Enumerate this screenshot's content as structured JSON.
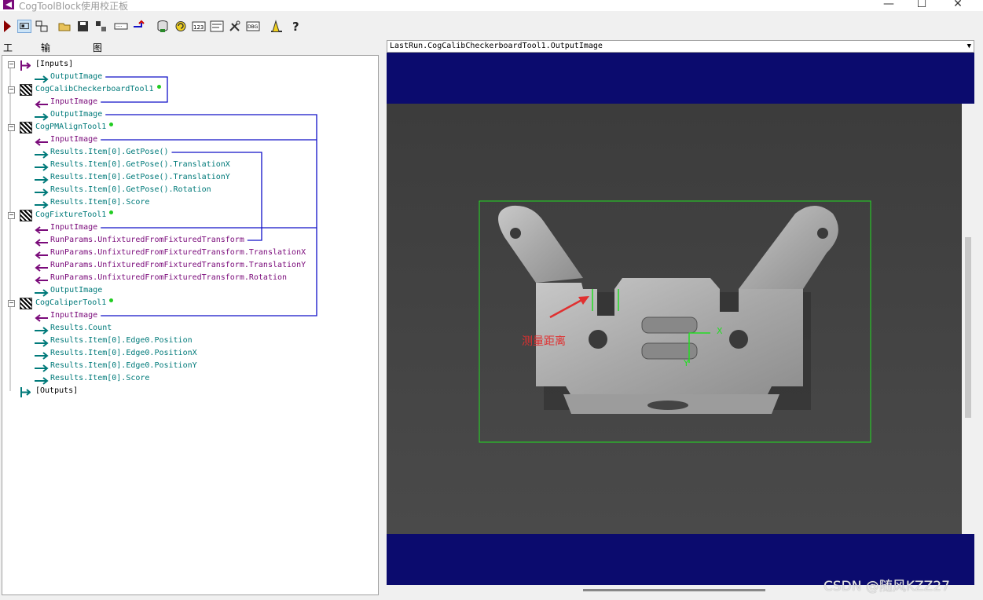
{
  "window": {
    "title": "CogToolBlock使用校正板"
  },
  "tabs": [
    "工具",
    "输入/输出",
    "图形"
  ],
  "tree": [
    {
      "text": "[Inputs]",
      "color": "black",
      "indent": 0,
      "node": true,
      "icon": "inputs-icon"
    },
    {
      "text": "OutputImage",
      "color": "teal",
      "indent": 2,
      "arrow": "out"
    },
    {
      "text": "CogCalibCheckerboardTool1",
      "color": "teal",
      "indent": 1,
      "node": true,
      "icon": "checkerboard-tool-icon",
      "status": true
    },
    {
      "text": "InputImage",
      "color": "purple",
      "indent": 2,
      "arrow": "in"
    },
    {
      "text": "OutputImage",
      "color": "teal",
      "indent": 2,
      "arrow": "out"
    },
    {
      "text": "CogPMAlignTool1",
      "color": "teal",
      "indent": 1,
      "node": true,
      "icon": "pmalign-tool-icon",
      "status": true
    },
    {
      "text": "InputImage",
      "color": "purple",
      "indent": 2,
      "arrow": "in"
    },
    {
      "text": "Results.Item[0].GetPose()",
      "color": "teal",
      "indent": 2,
      "arrow": "out"
    },
    {
      "text": "Results.Item[0].GetPose().TranslationX",
      "color": "teal",
      "indent": 2,
      "arrow": "out"
    },
    {
      "text": "Results.Item[0].GetPose().TranslationY",
      "color": "teal",
      "indent": 2,
      "arrow": "out"
    },
    {
      "text": "Results.Item[0].GetPose().Rotation",
      "color": "teal",
      "indent": 2,
      "arrow": "out"
    },
    {
      "text": "Results.Item[0].Score",
      "color": "teal",
      "indent": 2,
      "arrow": "out"
    },
    {
      "text": "CogFixtureTool1",
      "color": "teal",
      "indent": 1,
      "node": true,
      "icon": "fixture-tool-icon",
      "status": true
    },
    {
      "text": "InputImage",
      "color": "purple",
      "indent": 2,
      "arrow": "in"
    },
    {
      "text": "RunParams.UnfixturedFromFixturedTransform",
      "color": "purple",
      "indent": 2,
      "arrow": "in"
    },
    {
      "text": "RunParams.UnfixturedFromFixturedTransform.TranslationX",
      "color": "purple",
      "indent": 2,
      "arrow": "in"
    },
    {
      "text": "RunParams.UnfixturedFromFixturedTransform.TranslationY",
      "color": "purple",
      "indent": 2,
      "arrow": "in"
    },
    {
      "text": "RunParams.UnfixturedFromFixturedTransform.Rotation",
      "color": "purple",
      "indent": 2,
      "arrow": "in"
    },
    {
      "text": "OutputImage",
      "color": "teal",
      "indent": 2,
      "arrow": "out"
    },
    {
      "text": "CogCaliperTool1",
      "color": "teal",
      "indent": 1,
      "node": true,
      "icon": "caliper-tool-icon",
      "status": true
    },
    {
      "text": "InputImage",
      "color": "purple",
      "indent": 2,
      "arrow": "in"
    },
    {
      "text": "Results.Count",
      "color": "teal",
      "indent": 2,
      "arrow": "out"
    },
    {
      "text": "Results.Item[0].Edge0.Position",
      "color": "teal",
      "indent": 2,
      "arrow": "out"
    },
    {
      "text": "Results.Item[0].Edge0.PositionX",
      "color": "teal",
      "indent": 2,
      "arrow": "out"
    },
    {
      "text": "Results.Item[0].Edge0.PositionY",
      "color": "teal",
      "indent": 2,
      "arrow": "out"
    },
    {
      "text": "Results.Item[0].Score",
      "color": "teal",
      "indent": 2,
      "arrow": "out"
    },
    {
      "text": "[Outputs]",
      "color": "black",
      "indent": 0,
      "node": false,
      "icon": "outputs-icon"
    }
  ],
  "viewer": {
    "image_selector": "LastRun.CogCalibCheckerboardTool1.OutputImage",
    "annotation_label": "测量距离",
    "axis_x_label": "X",
    "axis_y_label": "Y"
  },
  "watermark": "CSDN @随风KZZ27",
  "colors": {
    "teal": "#007a7a",
    "purple": "#7a0a7a",
    "link_line": "#1010c8",
    "viewer_bg": "#0b0b6e",
    "roi": "#22dd22",
    "annotation": "#e03030"
  }
}
